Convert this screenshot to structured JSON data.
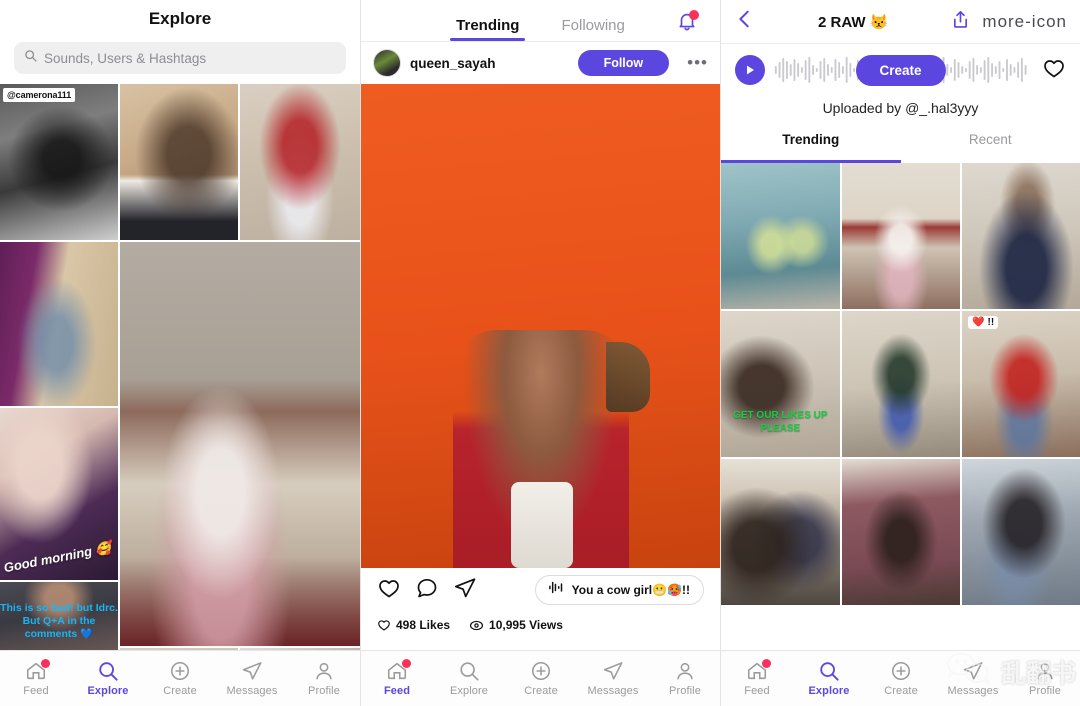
{
  "accent": {
    "purple": "#5b46e0",
    "pink": "#fb2f5c",
    "orange": "#e8521a"
  },
  "explore": {
    "title": "Explore",
    "search": {
      "placeholder": "Sounds, Users & Hashtags",
      "value": "",
      "icon": "search-icon"
    },
    "tiles": [
      {
        "badge": "@camerona111",
        "overlay": "",
        "overlay_kind": ""
      },
      {
        "badge": "",
        "overlay": "",
        "overlay_kind": ""
      },
      {
        "badge": "",
        "overlay": "",
        "overlay_kind": ""
      },
      {
        "badge": "",
        "overlay": "",
        "overlay_kind": ""
      },
      {
        "badge": "",
        "overlay": "",
        "overlay_kind": ""
      },
      {
        "badge": "",
        "overlay": "Good morning 🥰",
        "overlay_kind": "script"
      },
      {
        "badge": "",
        "overlay": "This is so bad! but Idrc.\nBut Q+A in the\ncomments 💙",
        "overlay_kind": "blue"
      },
      {
        "badge": "",
        "overlay": "",
        "overlay_kind": ""
      },
      {
        "badge": "",
        "overlay": "",
        "overlay_kind": ""
      }
    ],
    "tabbar": {
      "items": [
        {
          "label": "Feed",
          "icon": "home-icon",
          "active": false,
          "badge": true
        },
        {
          "label": "Explore",
          "icon": "search-icon",
          "active": true,
          "badge": false
        },
        {
          "label": "Create",
          "icon": "plus-circle-icon",
          "active": false,
          "badge": false
        },
        {
          "label": "Messages",
          "icon": "send-icon",
          "active": false,
          "badge": false
        },
        {
          "label": "Profile",
          "icon": "person-icon",
          "active": false,
          "badge": false
        }
      ]
    }
  },
  "feed": {
    "tabs": [
      {
        "label": "Trending",
        "active": true
      },
      {
        "label": "Following",
        "active": false
      }
    ],
    "bell": {
      "icon": "bell-icon",
      "badge": true
    },
    "post": {
      "username": "queen_sayah",
      "follow_label": "Follow",
      "more_label": "•••",
      "sound_label": "You a cow girl😬🥵!!",
      "likes": "498 Likes",
      "views": "10,995 Views",
      "actions": [
        {
          "icon": "heart-icon",
          "name": "like-button"
        },
        {
          "icon": "comment-icon",
          "name": "comment-button"
        },
        {
          "icon": "send-icon",
          "name": "share-button"
        }
      ]
    },
    "tabbar": {
      "items": [
        {
          "label": "Feed",
          "icon": "home-icon",
          "active": true,
          "badge": true
        },
        {
          "label": "Explore",
          "icon": "search-icon",
          "active": false,
          "badge": false
        },
        {
          "label": "Create",
          "icon": "plus-circle-icon",
          "active": false,
          "badge": false
        },
        {
          "label": "Messages",
          "icon": "send-icon",
          "active": false,
          "badge": false
        },
        {
          "label": "Profile",
          "icon": "person-icon",
          "active": false,
          "badge": false
        }
      ]
    }
  },
  "sound": {
    "back_icon": "chevron-left-icon",
    "title": "2 RAW 😾",
    "share_icon": "share-up-icon",
    "more_icon": "more-icon",
    "play_icon": "play-icon",
    "create_label": "Create",
    "favorite_icon": "heart-icon",
    "uploader": "Uploaded by @_.hal3yyy",
    "tabs": [
      {
        "label": "Trending",
        "active": true
      },
      {
        "label": "Recent",
        "active": false
      }
    ],
    "cells": [
      {
        "overlay": "",
        "overlay_kind": ""
      },
      {
        "overlay": "",
        "overlay_kind": ""
      },
      {
        "overlay": "",
        "overlay_kind": ""
      },
      {
        "overlay": "GET OUR LIKES UP\nPLEASE",
        "overlay_kind": "green"
      },
      {
        "overlay": "",
        "overlay_kind": ""
      },
      {
        "overlay": "❤️ !!",
        "overlay_kind": "heart"
      },
      {
        "overlay": "",
        "overlay_kind": ""
      },
      {
        "overlay": "",
        "overlay_kind": ""
      },
      {
        "overlay": "",
        "overlay_kind": ""
      }
    ],
    "tabbar": {
      "items": [
        {
          "label": "Feed",
          "icon": "home-icon",
          "active": false,
          "badge": true
        },
        {
          "label": "Explore",
          "icon": "search-icon",
          "active": true,
          "badge": false
        },
        {
          "label": "Create",
          "icon": "plus-circle-icon",
          "active": false,
          "badge": false
        },
        {
          "label": "Messages",
          "icon": "send-icon",
          "active": false,
          "badge": false
        },
        {
          "label": "Profile",
          "icon": "person-icon",
          "active": false,
          "badge": false
        }
      ]
    }
  },
  "watermark": {
    "text": "乱翻书",
    "icon": "wechat-icon"
  }
}
